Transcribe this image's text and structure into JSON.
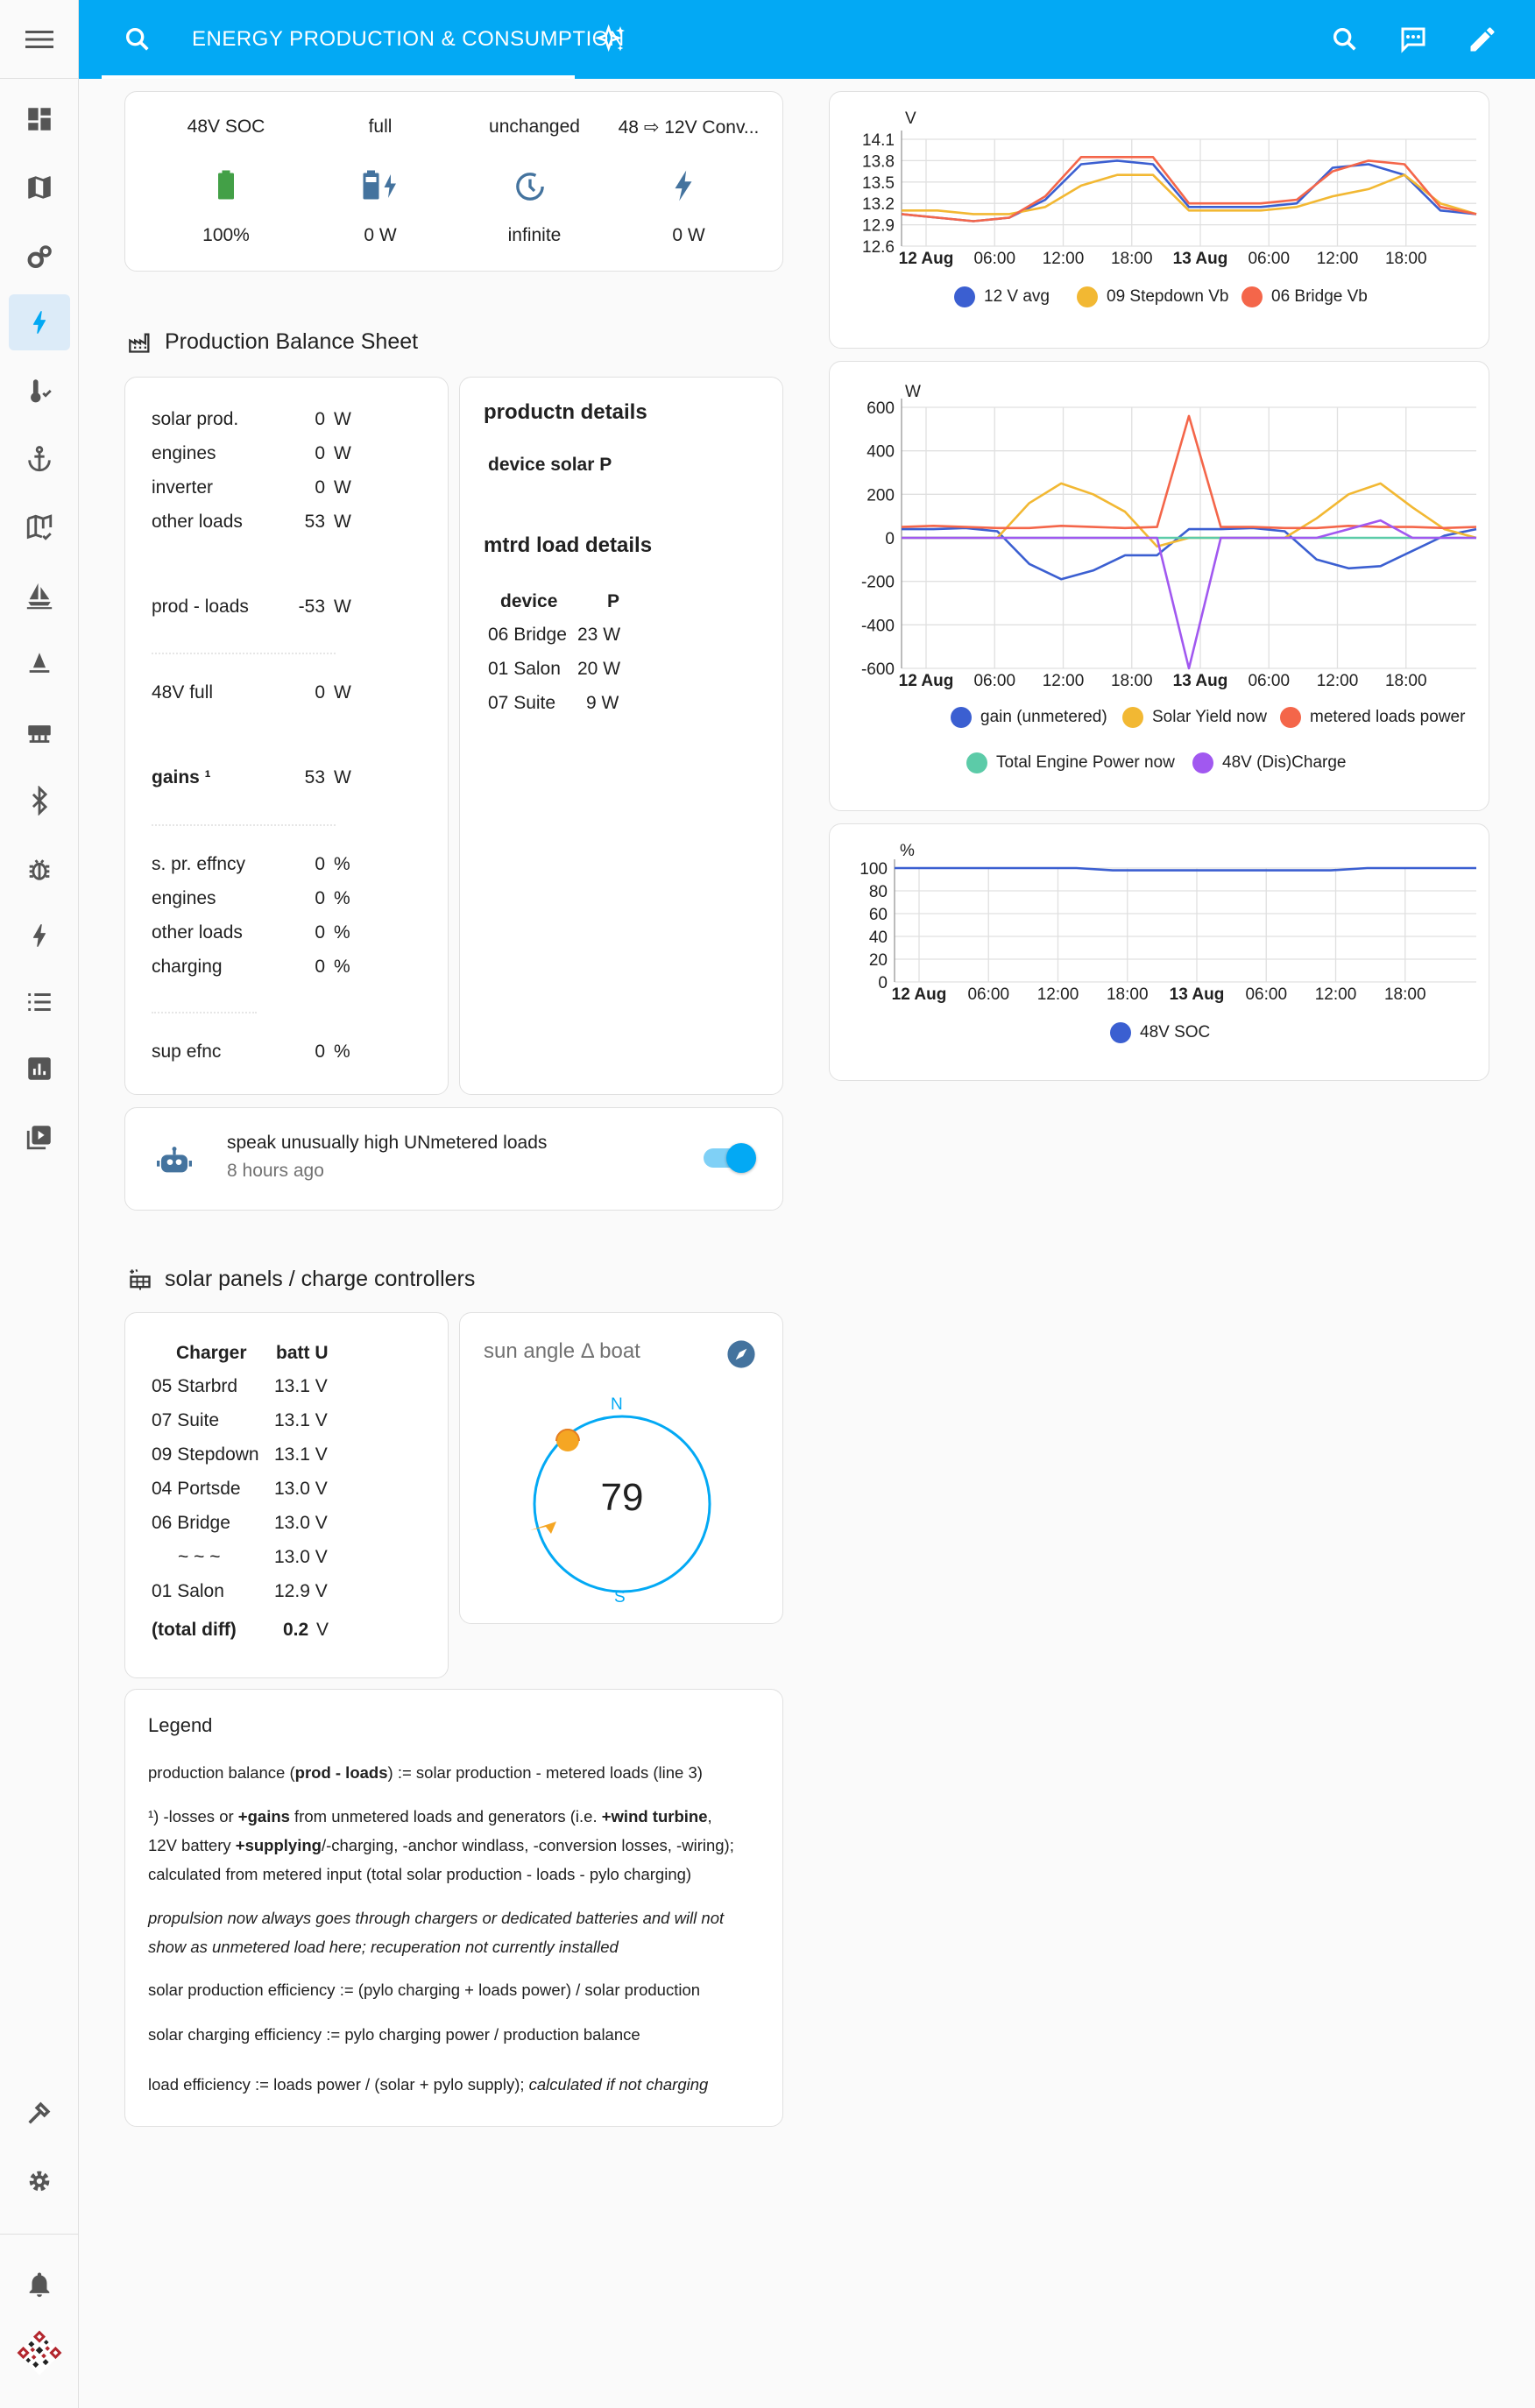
{
  "header": {
    "title": "ENERGY PRODUCTION & CONSUMPTION"
  },
  "sidebar": {
    "items": [
      "dashboard-icon",
      "map-icon",
      "cogs-icon",
      "lightning-icon",
      "thermometer-icon",
      "anchor-icon",
      "map-check-icon",
      "sailboat-icon",
      "buoy-icon",
      "server-icon",
      "bluetooth-icon",
      "bug-icon",
      "lightning-2-icon",
      "list-icon",
      "chart-box-icon",
      "video-box-icon"
    ],
    "bottom": [
      "hammer-icon",
      "gear-icon",
      "bell-icon",
      "qr-icon"
    ]
  },
  "battery_glance": {
    "items": [
      {
        "name": "48V SOC",
        "value": "100%",
        "icon": "battery-full-icon"
      },
      {
        "name": "full",
        "value": "0 W",
        "icon": "battery-charging-icon"
      },
      {
        "name": "unchanged",
        "value": "infinite",
        "icon": "clock-icon"
      },
      {
        "name": "48 ⇨ 12V Conv...",
        "value": "0 W",
        "icon": "flash-icon"
      }
    ]
  },
  "production_section": {
    "title": "Production Balance Sheet"
  },
  "balance": {
    "rows": [
      {
        "label": "solar prod.",
        "value": "0",
        "unit": "W"
      },
      {
        "label": "engines",
        "value": "0",
        "unit": "W"
      },
      {
        "label": "inverter",
        "value": "0",
        "unit": "W"
      },
      {
        "label": "other loads",
        "value": "53",
        "unit": "W"
      },
      {
        "label": "prod - loads",
        "value": "-53",
        "unit": "W"
      },
      {
        "label": "48V full",
        "value": "0",
        "unit": "W"
      },
      {
        "label": "gains ¹",
        "value": "53",
        "unit": "W"
      },
      {
        "label": "s. pr. effncy",
        "value": "0",
        "unit": "%"
      },
      {
        "label": "engines",
        "value": "0",
        "unit": "%"
      },
      {
        "label": "other loads",
        "value": "0",
        "unit": "%"
      },
      {
        "label": "charging",
        "value": "0",
        "unit": "%"
      },
      {
        "label": "sup efnc",
        "value": "0",
        "unit": "%"
      }
    ]
  },
  "details": {
    "title1": "productn details",
    "sub1": "device solar P",
    "title2": "mtrd load details",
    "col_device": "device",
    "col_p": "P",
    "rows": [
      {
        "device": "06 Bridge",
        "p": "23 W"
      },
      {
        "device": "01 Salon",
        "p": "20 W"
      },
      {
        "device": "07 Suite",
        "p": "9 W"
      }
    ]
  },
  "automation": {
    "name": "speak unusually high UNmetered loads",
    "time": "8 hours ago",
    "on": true
  },
  "solar_section": {
    "title": "solar panels / charge controllers"
  },
  "chargers": {
    "col_charger": "Charger",
    "col_batt": "batt U",
    "rows": [
      {
        "name": "05 Starbrd",
        "u": "13.1 V"
      },
      {
        "name": "07 Suite",
        "u": "13.1 V"
      },
      {
        "name": "09 Stepdown",
        "u": "13.1 V"
      },
      {
        "name": "04 Portsde",
        "u": "13.0 V"
      },
      {
        "name": "06 Bridge",
        "u": "13.0 V"
      },
      {
        "name": "~ ~ ~",
        "u": "13.0 V"
      },
      {
        "name": "01 Salon",
        "u": "12.9 V"
      }
    ],
    "total_label": "(total diff)",
    "total_value": "0.2",
    "total_unit": "V"
  },
  "sun": {
    "title": "sun angle Δ boat",
    "value": "79",
    "n": "N",
    "s": "S"
  },
  "legend": {
    "title": "Legend",
    "l1a": "production balance (",
    "l1b": "prod - loads",
    "l1c": ") := solar production - metered loads (line 3)",
    "l2a": "¹) -losses or ",
    "l2b": "+gains",
    "l2c": " from unmetered loads and generators (i.e. ",
    "l2d": "+wind turbine",
    "l2e": ",",
    "l3a": "12V battery ",
    "l3b": "+supplying",
    "l3c": "/-charging, -anchor windlass, -conversion losses, -wiring);",
    "l4": "calculated from metered input (total solar production - loads - pylo charging)",
    "l5": "propulsion now always goes through chargers or dedicated batteries and will not",
    "l6": "show as unmetered load here; recuperation not currently installed",
    "l7": "solar production efficiency := (pylo charging + loads power) / solar production",
    "l8": "solar charging efficiency := pylo charging power / production balance",
    "l9a": "load efficiency := loads power / (solar + pylo supply); ",
    "l9b": "calculated if not charging"
  },
  "colors": {
    "blue": "#3b5fd1",
    "yellow": "#f2b833",
    "red": "#f4664a",
    "teal": "#5ccba8",
    "purple": "#a158f0",
    "accent": "#03a9f4"
  },
  "chart_data": [
    {
      "type": "line",
      "ylabel": "V",
      "ylim": [
        12.6,
        14.1
      ],
      "yticks": [
        "14.1",
        "13.8",
        "13.5",
        "13.2",
        "12.9",
        "12.6"
      ],
      "xticks": [
        "12 Aug",
        "06:00",
        "12:00",
        "18:00",
        "13 Aug",
        "06:00",
        "12:00",
        "18:00"
      ],
      "series": [
        {
          "name": "12 V avg",
          "color": "#3b5fd1",
          "values": [
            13.05,
            13.0,
            12.95,
            13.0,
            13.25,
            13.75,
            13.8,
            13.75,
            13.15,
            13.15,
            13.15,
            13.2,
            13.7,
            13.75,
            13.6,
            13.1,
            13.05
          ]
        },
        {
          "name": "09 Stepdown Vb",
          "color": "#f2b833",
          "values": [
            13.1,
            13.1,
            13.05,
            13.05,
            13.15,
            13.45,
            13.6,
            13.6,
            13.1,
            13.1,
            13.1,
            13.15,
            13.3,
            13.4,
            13.6,
            13.2,
            13.05
          ]
        },
        {
          "name": "06 Bridge Vb",
          "color": "#f4664a",
          "values": [
            13.05,
            13.0,
            12.95,
            13.0,
            13.3,
            13.85,
            13.85,
            13.85,
            13.2,
            13.2,
            13.2,
            13.25,
            13.65,
            13.8,
            13.75,
            13.15,
            13.05
          ]
        }
      ]
    },
    {
      "type": "line",
      "ylabel": "W",
      "ylim": [
        -600,
        600
      ],
      "yticks": [
        "600",
        "400",
        "200",
        "0",
        "-200",
        "-400",
        "-600"
      ],
      "xticks": [
        "12 Aug",
        "06:00",
        "12:00",
        "18:00",
        "13 Aug",
        "06:00",
        "12:00",
        "18:00"
      ],
      "series": [
        {
          "name": "gain (unmetered)",
          "color": "#3b5fd1",
          "values": [
            40,
            40,
            45,
            30,
            -120,
            -190,
            -150,
            -80,
            -80,
            40,
            40,
            45,
            30,
            -100,
            -140,
            -130,
            -60,
            10,
            40
          ]
        },
        {
          "name": "Solar Yield now",
          "color": "#f2b833",
          "values": [
            0,
            0,
            0,
            0,
            160,
            250,
            200,
            120,
            -40,
            0,
            0,
            0,
            0,
            90,
            200,
            250,
            140,
            40,
            0
          ]
        },
        {
          "name": "metered loads power",
          "color": "#f4664a",
          "values": [
            50,
            55,
            50,
            45,
            45,
            55,
            50,
            45,
            50,
            560,
            50,
            50,
            45,
            45,
            55,
            50,
            50,
            45,
            50
          ]
        },
        {
          "name": "Total Engine Power now",
          "color": "#5ccba8",
          "values": [
            0,
            0,
            0,
            0,
            0,
            0,
            0,
            0,
            0,
            0,
            0,
            0,
            0,
            0,
            0,
            0,
            0,
            0,
            0
          ]
        },
        {
          "name": "48V (Dis)Charge",
          "color": "#a158f0",
          "values": [
            0,
            0,
            0,
            0,
            0,
            0,
            0,
            0,
            0,
            -600,
            0,
            0,
            0,
            0,
            40,
            80,
            0,
            0,
            0
          ]
        }
      ]
    },
    {
      "type": "line",
      "ylabel": "%",
      "ylim": [
        0,
        100
      ],
      "yticks": [
        "100",
        "80",
        "60",
        "40",
        "20",
        "0"
      ],
      "xticks": [
        "12 Aug",
        "06:00",
        "12:00",
        "18:00",
        "13 Aug",
        "06:00",
        "12:00",
        "18:00"
      ],
      "series": [
        {
          "name": "48V SOC",
          "color": "#3b5fd1",
          "values": [
            100,
            100,
            100,
            100,
            100,
            100,
            98,
            98,
            98,
            98,
            98,
            98,
            98,
            100,
            100,
            100,
            100
          ]
        }
      ]
    }
  ]
}
